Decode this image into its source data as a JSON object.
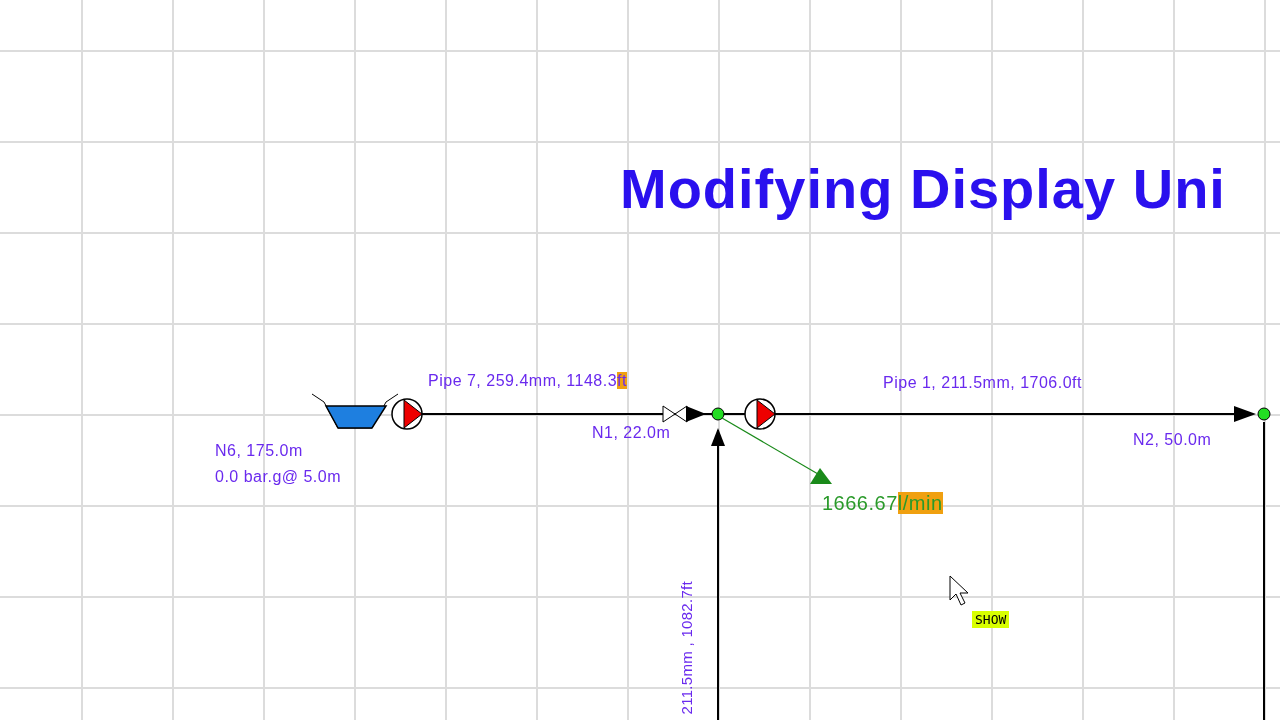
{
  "title": "Modifying Display Uni",
  "pipes": [
    {
      "label": "Pipe 7, 259.4mm, 1148.3",
      "unit": "ft",
      "unit_highlighted": true
    },
    {
      "label": "Pipe 1, 211.5mm, 1706.0ft"
    },
    {
      "label": "211.5mm , 1082.7ft"
    }
  ],
  "nodes": [
    {
      "lines": [
        "N6, 175.0m",
        "0.0 bar.g@ 5.0m"
      ]
    },
    {
      "lines": [
        "N1, 22.0m"
      ]
    },
    {
      "lines": [
        "N2, 50.0m"
      ]
    }
  ],
  "flow": {
    "value": "1666.67",
    "unit": "l/min",
    "unit_highlighted": true
  },
  "tooltip": "SHOW"
}
